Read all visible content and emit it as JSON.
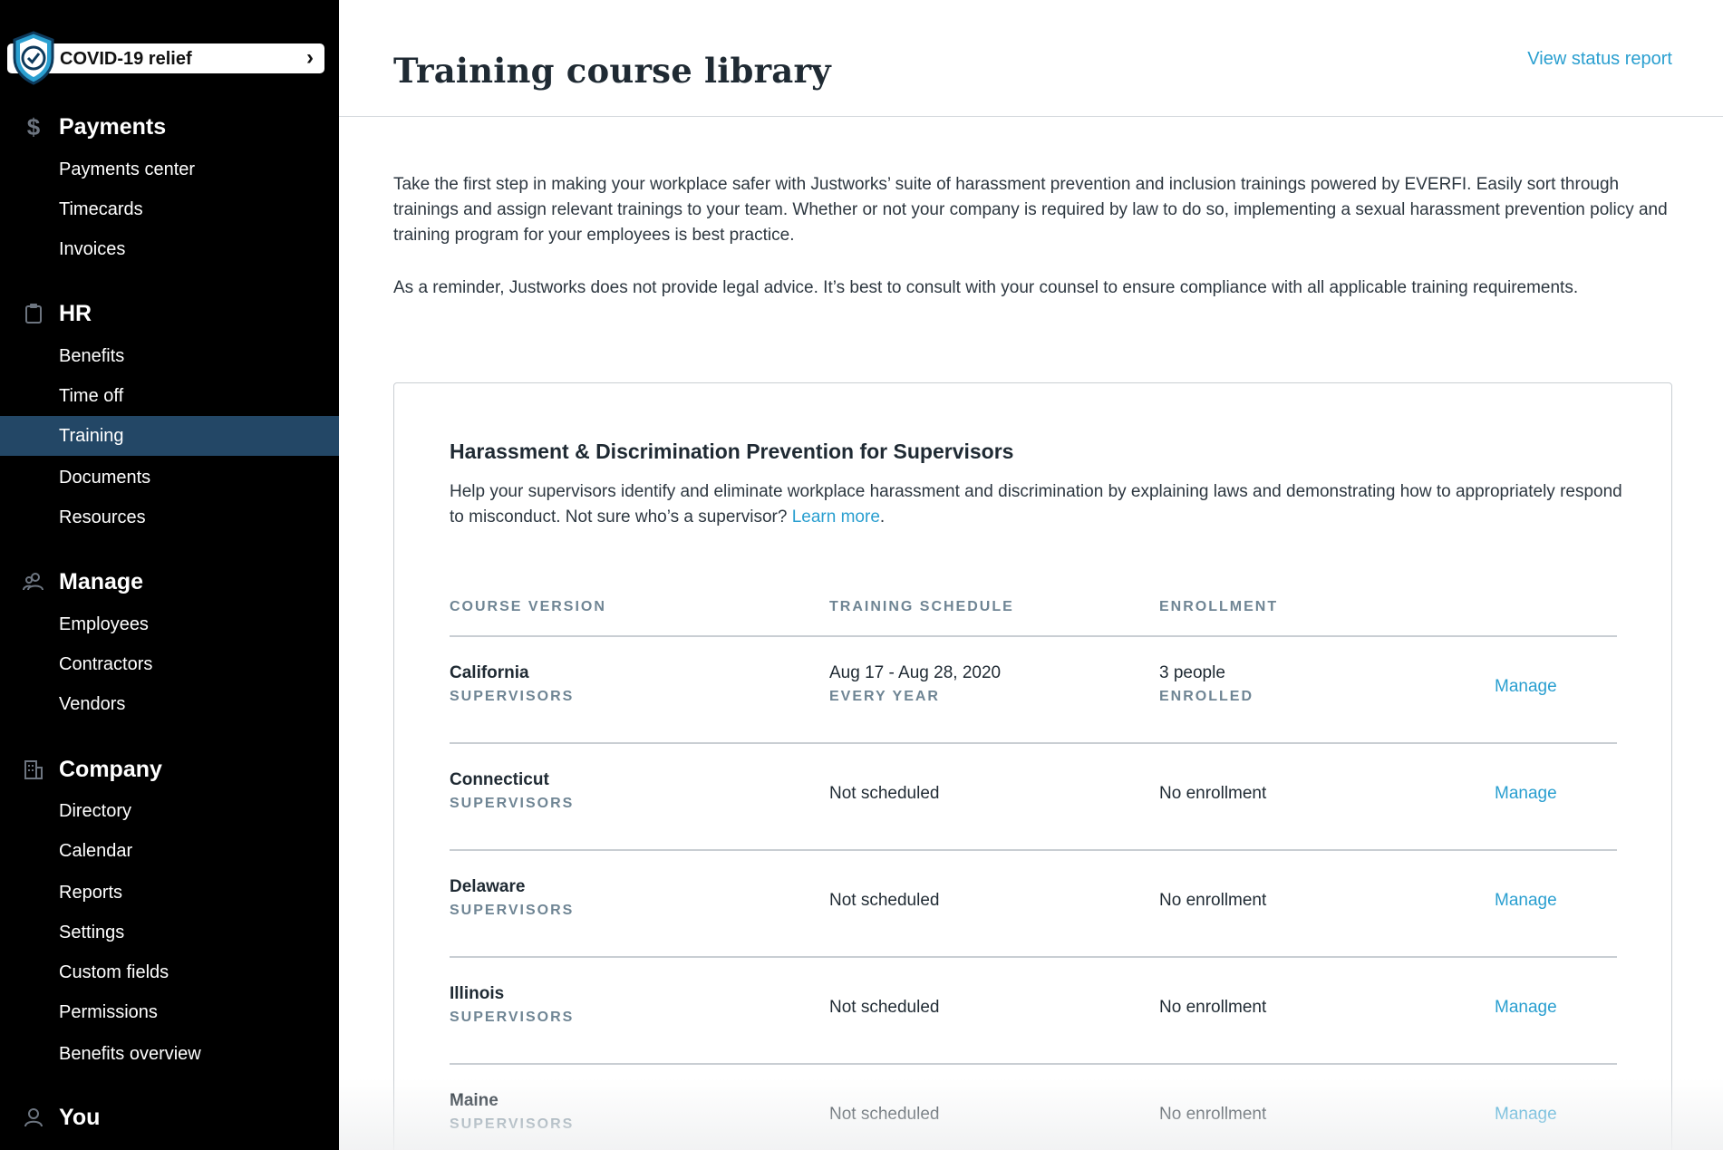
{
  "sidebar": {
    "covid_label": "COVID-19 relief",
    "sections": [
      {
        "label": "Payments",
        "icon": "dollar-icon",
        "items": [
          "Payments center",
          "Timecards",
          "Invoices"
        ]
      },
      {
        "label": "HR",
        "icon": "clipboard-icon",
        "items": [
          "Benefits",
          "Time off",
          "Training",
          "Documents",
          "Resources"
        ]
      },
      {
        "label": "Manage",
        "icon": "people-icon",
        "items": [
          "Employees",
          "Contractors",
          "Vendors"
        ]
      },
      {
        "label": "Company",
        "icon": "building-icon",
        "items": [
          "Directory",
          "Calendar",
          "Reports",
          "Settings",
          "Custom fields",
          "Permissions",
          "Benefits overview"
        ]
      },
      {
        "label": "You",
        "icon": "person-icon",
        "items": []
      }
    ],
    "active_item": "Training"
  },
  "header": {
    "title": "Training course library",
    "status_link": "View status report"
  },
  "intro": {
    "p1": "Take the first step in making your workplace safer with Justworks’ suite of harassment prevention and inclusion trainings powered by EVERFI. Easily sort through trainings and assign relevant trainings to your team. Whether or not your company is required by law to do so, implementing a sexual harassment prevention policy and training program for your employees is best practice.",
    "p2": "As a reminder, Justworks does not provide legal advice. It’s best to consult with your counsel to ensure compliance with all applicable training requirements."
  },
  "course": {
    "title": "Harassment & Discrimination Prevention for Supervisors",
    "desc": "Help your supervisors identify and eliminate workplace harassment and discrimination by explaining laws and demonstrating how to appropriately respond to misconduct. Not sure who’s a supervisor? ",
    "learn_more": "Learn more",
    "desc_end": ".",
    "columns": [
      "COURSE VERSION",
      "TRAINING SCHEDULE",
      "ENROLLMENT"
    ],
    "rows": [
      {
        "state": "California",
        "audience": "SUPERVISORS",
        "schedule": "Aug 17 - Aug 28, 2020",
        "schedule_sub": "EVERY YEAR",
        "enrollment": "3 people",
        "enrollment_sub": "ENROLLED",
        "action": "Manage"
      },
      {
        "state": "Connecticut",
        "audience": "SUPERVISORS",
        "schedule": "Not scheduled",
        "schedule_sub": "",
        "enrollment": "No enrollment",
        "enrollment_sub": "",
        "action": "Manage"
      },
      {
        "state": "Delaware",
        "audience": "SUPERVISORS",
        "schedule": "Not scheduled",
        "schedule_sub": "",
        "enrollment": "No enrollment",
        "enrollment_sub": "",
        "action": "Manage"
      },
      {
        "state": "Illinois",
        "audience": "SUPERVISORS",
        "schedule": "Not scheduled",
        "schedule_sub": "",
        "enrollment": "No enrollment",
        "enrollment_sub": "",
        "action": "Manage"
      },
      {
        "state": "Maine",
        "audience": "SUPERVISORS",
        "schedule": "Not scheduled",
        "schedule_sub": "",
        "enrollment": "No enrollment",
        "enrollment_sub": "",
        "action": "Manage"
      }
    ]
  },
  "colors": {
    "accent": "#2a9fd0",
    "sidebar_bg": "#000000",
    "active_bg": "#234766",
    "muted": "#6f8594"
  }
}
